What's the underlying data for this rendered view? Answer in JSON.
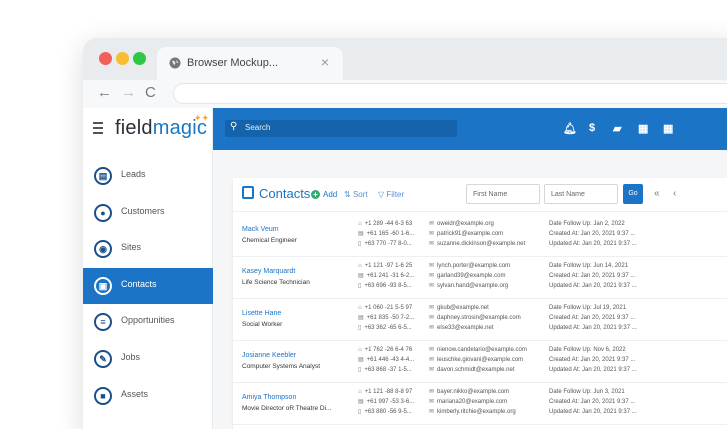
{
  "browser": {
    "tab_title": "Browser Mockup...",
    "tab_close": "×",
    "nav": {
      "back": "←",
      "forward": "→",
      "reload": "C"
    }
  },
  "app": {
    "logo_prefix": "field",
    "logo_suffix": "magic",
    "search_placeholder": "Search",
    "sidebar": [
      {
        "label": "Leads",
        "icon": "leads-icon",
        "glyph": "▤",
        "active": false
      },
      {
        "label": "Customers",
        "icon": "customers-icon",
        "glyph": "●",
        "active": false
      },
      {
        "label": "Sites",
        "icon": "location-pin-icon",
        "glyph": "◉",
        "active": false
      },
      {
        "label": "Contacts",
        "icon": "contacts-icon",
        "glyph": "▣",
        "active": true
      },
      {
        "label": "Opportunities",
        "icon": "list-icon",
        "glyph": "≡",
        "active": false
      },
      {
        "label": "Jobs",
        "icon": "wrench-icon",
        "glyph": "✎",
        "active": false
      },
      {
        "label": "Assets",
        "icon": "briefcase-icon",
        "glyph": "■",
        "active": false
      }
    ],
    "toolbar_icons": [
      "bell-icon",
      "dollar-icon",
      "toolbox-icon",
      "calendar-icon",
      "calendar-icon-2"
    ]
  },
  "contacts": {
    "title": "Contacts",
    "add_label": "Add",
    "sort_label": "Sort",
    "filter_label": "Filter",
    "first_name_placeholder": "First Name",
    "last_name_placeholder": "Last Name",
    "go_label": "Go",
    "pager_first": "«",
    "pager_prev": "‹",
    "rows": [
      {
        "name": "Mack Veum",
        "job": "Chemical Engineer",
        "phones": [
          "+1 289 -44 6-3 63",
          "+61 165 -60 1-6...",
          "+63 770 -77 8-0..."
        ],
        "emails": [
          "oweidr@example.org",
          "patrick91@example.com",
          "suzanne.dickinson@example.net"
        ],
        "dates": [
          "Date Follow Up: Jan 2, 2022",
          "Created At: Jan 20, 2021 9:37 ...",
          "Updated At: Jan 20, 2021 9:37 ..."
        ]
      },
      {
        "name": "Kasey Marquardt",
        "job": "Life Science Technician",
        "phones": [
          "+1 121 -97 1-6 25",
          "+61 241 -31 6-2...",
          "+63 696 -93 8-5..."
        ],
        "emails": [
          "lynch.porter@example.com",
          "garland39@example.com",
          "sylvan.hand@example.org"
        ],
        "dates": [
          "Date Follow Up: Jun 14, 2021",
          "Created At: Jan 20, 2021 9:37 ...",
          "Updated At: Jan 20, 2021 9:37 ..."
        ]
      },
      {
        "name": "Lisette Hane",
        "job": "Social Worker",
        "phones": [
          "+1 060 -21 5-5 97",
          "+61 835 -50 7-2...",
          "+63 362 -65 6-5..."
        ],
        "emails": [
          "gkub@example.net",
          "daphney.strosin@example.com",
          "else33@example.net"
        ],
        "dates": [
          "Date Follow Up: Jul 19, 2021",
          "Created At: Jan 20, 2021 9:37 ...",
          "Updated At: Jan 20, 2021 9:37 ..."
        ]
      },
      {
        "name": "Josianne Keebler",
        "job": "Computer Systems Analyst",
        "phones": [
          "+1 762 -26 6-4 76",
          "+61 446 -43 4-4...",
          "+63 868 -37 1-5..."
        ],
        "emails": [
          "nienow.candelario@example.com",
          "leuschke.giovani@example.com",
          "davon.schmidt@example.net"
        ],
        "dates": [
          "Date Follow Up: Nov 6, 2022",
          "Created At: Jan 20, 2021 9:37 ...",
          "Updated At: Jan 20, 2021 9:37 ..."
        ]
      },
      {
        "name": "Amiya Thompson",
        "job": "Movie Director oR Theatre Di...",
        "phones": [
          "+1 121 -88 8-8 97",
          "+61 997 -53 3-6...",
          "+63 880 -56 9-5..."
        ],
        "emails": [
          "bayer.nikko@example.com",
          "mariana20@example.com",
          "kimberly.ritchie@example.org"
        ],
        "dates": [
          "Date Follow Up: Jun 3, 2021",
          "Created At: Jan 20, 2021 9:37 ...",
          "Updated At: Jan 20, 2021 9:37 ..."
        ]
      }
    ]
  },
  "colors": {
    "primary": "#1b74c5",
    "active_nav": "#1b74c5",
    "add_green": "#2ab06f"
  }
}
